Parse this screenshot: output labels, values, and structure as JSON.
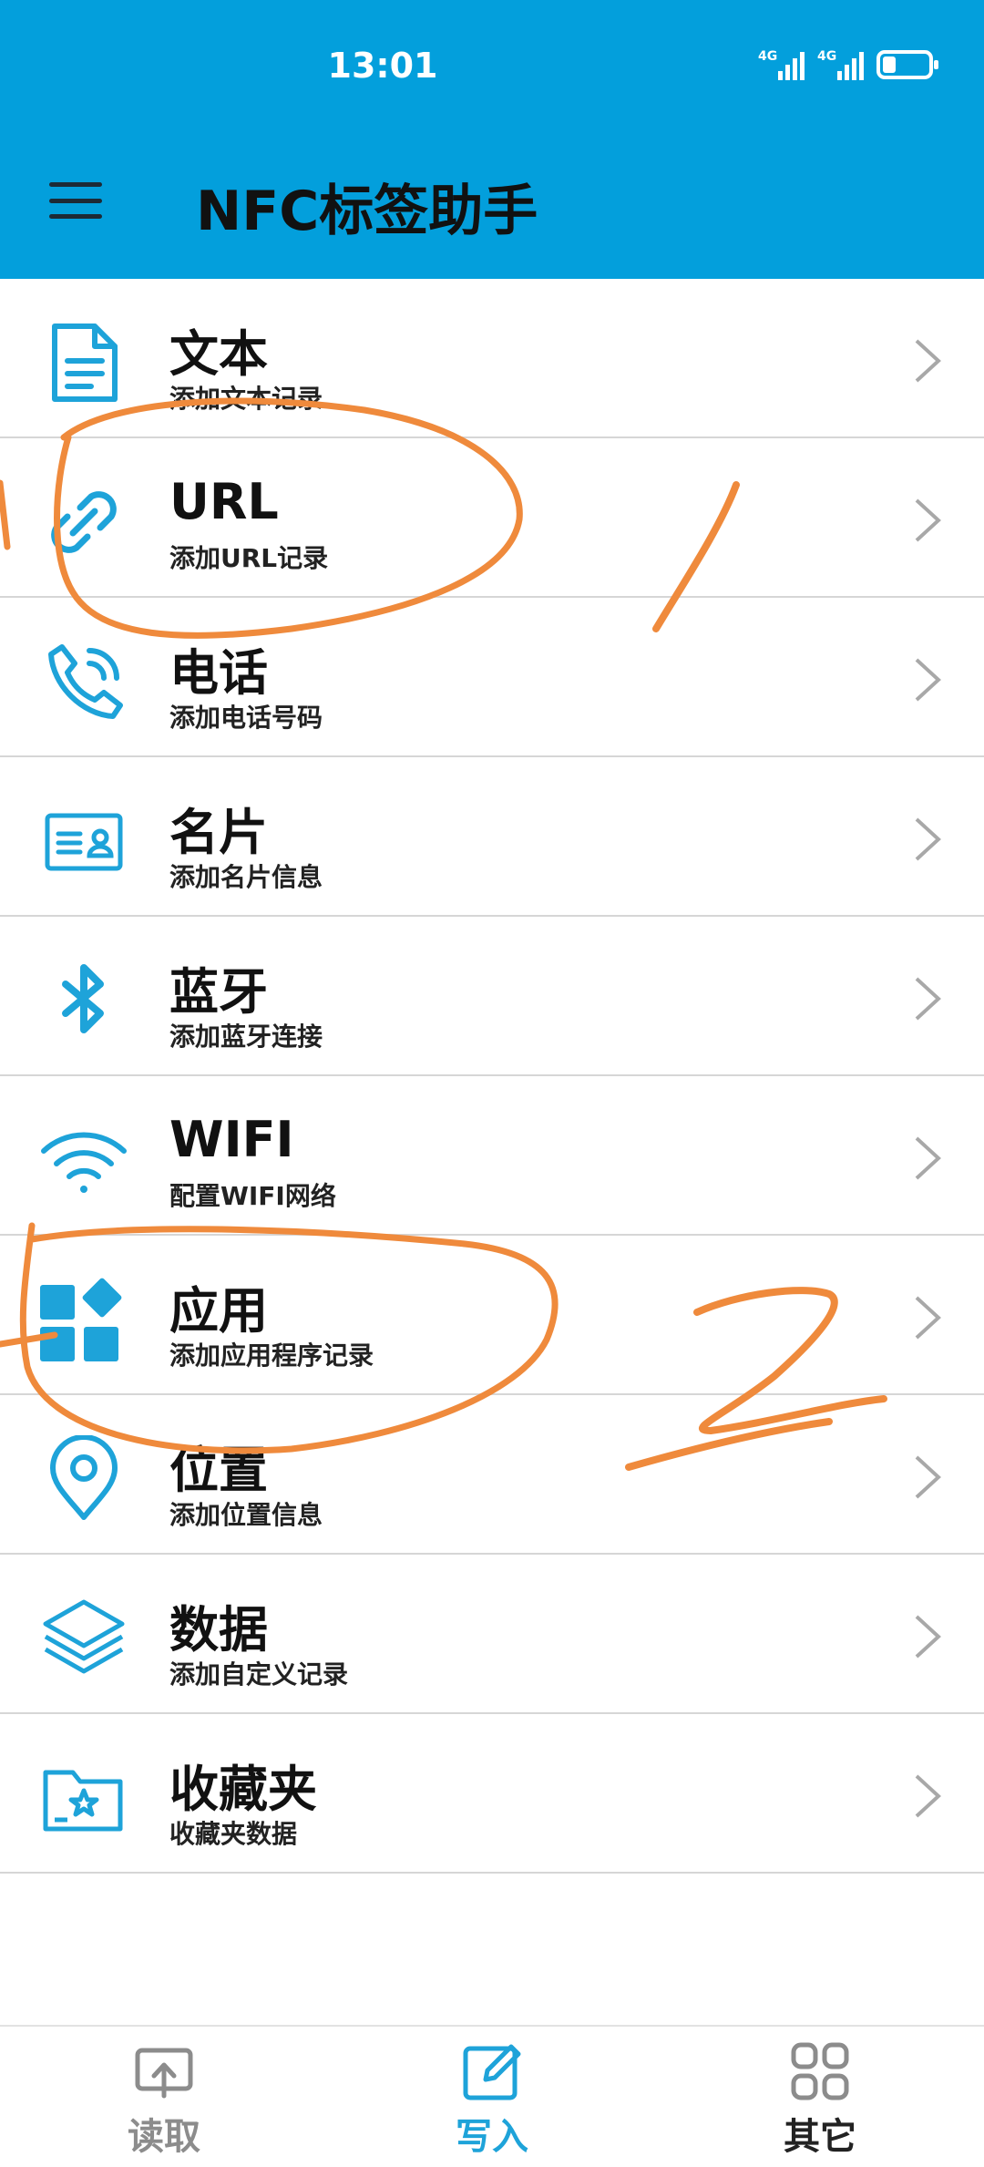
{
  "status": {
    "time": "13:01",
    "net1": "4G",
    "net2": "4G",
    "battery_level": 0.3
  },
  "header": {
    "title": "NFC标签助手"
  },
  "items": [
    {
      "title": "文本",
      "subtitle": "添加文本记录"
    },
    {
      "title": "URL",
      "subtitle": "添加URL记录"
    },
    {
      "title": "电话",
      "subtitle": "添加电话号码"
    },
    {
      "title": "名片",
      "subtitle": "添加名片信息"
    },
    {
      "title": "蓝牙",
      "subtitle": "添加蓝牙连接"
    },
    {
      "title": "WIFI",
      "subtitle": "配置WIFI网络"
    },
    {
      "title": "应用",
      "subtitle": "添加应用程序记录"
    },
    {
      "title": "位置",
      "subtitle": "添加位置信息"
    },
    {
      "title": "数据",
      "subtitle": "添加自定义记录"
    },
    {
      "title": "收藏夹",
      "subtitle": "收藏夹数据"
    }
  ],
  "icons": [
    "document-icon",
    "link-icon",
    "phone-icon",
    "business-card-icon",
    "bluetooth-icon",
    "wifi-icon",
    "apps-icon",
    "location-pin-icon",
    "layers-icon",
    "folder-star-icon"
  ],
  "tabs": [
    {
      "label": "读取",
      "icon": "read-icon",
      "active": false
    },
    {
      "label": "写入",
      "icon": "write-icon",
      "active": true
    },
    {
      "label": "其它",
      "icon": "grid-icon",
      "active": false
    }
  ],
  "annotations": {
    "mark1": "1",
    "mark2": "2"
  },
  "colors": {
    "header_bg": "#039fdc",
    "icon": "#1ea3d9",
    "annotation": "#ef8a3c",
    "tab_active": "#1ea3d9",
    "tab_inactive": "#8c8c8c"
  }
}
